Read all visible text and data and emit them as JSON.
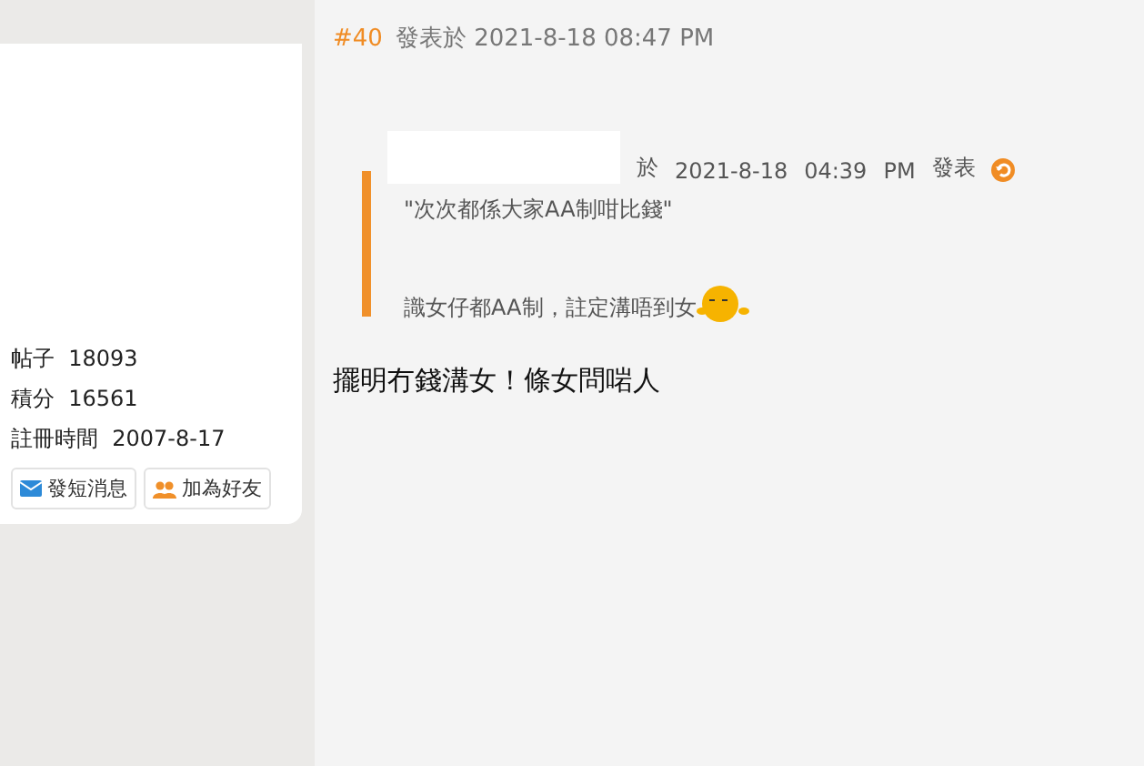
{
  "profile": {
    "stats": [
      {
        "label": "帖子",
        "value": "18093"
      },
      {
        "label": "積分",
        "value": "16561"
      },
      {
        "label": "註冊時間",
        "value": "2007-8-17"
      }
    ],
    "buttons": [
      {
        "label": "發短消息",
        "kind": "message"
      },
      {
        "label": "加為好友",
        "kind": "friend"
      }
    ]
  },
  "post": {
    "number": "#40",
    "posted": "發表於 2021-8-18 08:47 PM",
    "quote": {
      "prefix": "於",
      "date": "2021-8-18",
      "time": "04:39",
      "ampm": "PM",
      "suffix": "發表",
      "lines": [
        "\"次次都係大家AA制咁比錢\"",
        "識女仔都AA制，註定溝唔到女"
      ]
    },
    "body": "擺明冇錢溝女！條女問啱人"
  }
}
